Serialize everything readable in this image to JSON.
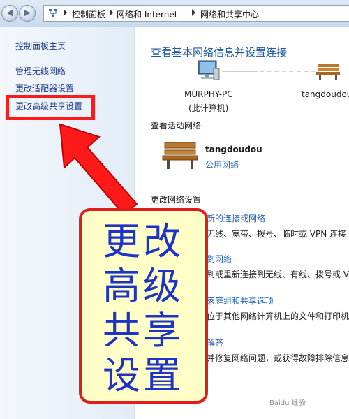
{
  "breadcrumb": {
    "items": [
      "控制面板",
      "网络和 Internet",
      "网络和共享中心"
    ]
  },
  "sidebar": {
    "home": "控制面板主页",
    "items": [
      "管理无线网络",
      "更改适配器设置",
      "更改高级共享设置"
    ]
  },
  "main": {
    "title": "查看基本网络信息并设置连接",
    "computer_name": "MURPHY-PC",
    "computer_sub": "(此计算机)",
    "network_node": "tangdoudou",
    "active_title": "查看活动网络",
    "active_network": {
      "name": "tangdoudou",
      "type": "公用网络"
    },
    "change_title": "更改网络设置",
    "tasks": [
      {
        "link": "新的连接或网络",
        "desc": "无线、宽带、拨号、临时或 VPN 连接"
      },
      {
        "link": "到网络",
        "desc": "到或重新连接到无线、有线、拨号或 VI"
      },
      {
        "link": "家庭组和共享选项",
        "desc": "位于其他网络计算机上的文件和打印机"
      },
      {
        "link": "解答",
        "desc": "并修复网络问题，或获得故障排除信息"
      }
    ]
  },
  "annotation": {
    "lines": [
      "更改",
      "高级",
      "共享",
      "设置"
    ]
  },
  "watermark": "Baidu 经验",
  "colors": {
    "accent": "#1e5fb4",
    "annotation_red": "#ff1a1a",
    "annotation_text": "#1f33c7",
    "callout_bg": "#ffffc8"
  }
}
